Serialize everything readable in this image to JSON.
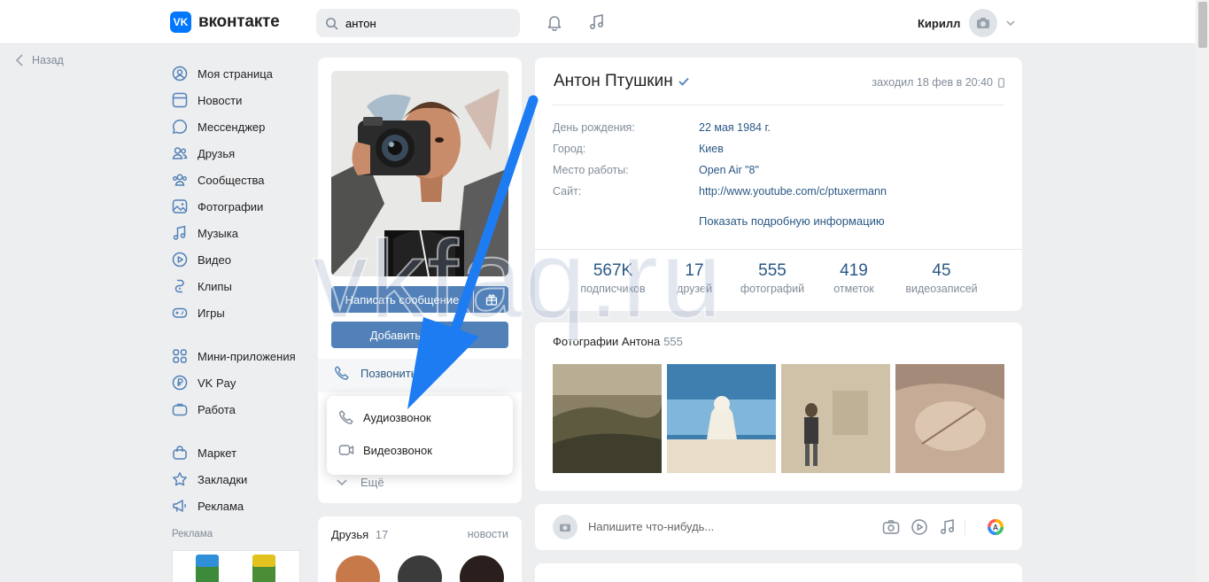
{
  "header": {
    "logo_text": "вконтакте",
    "search_value": "антон",
    "user_name": "Кирилл"
  },
  "back_label": "Назад",
  "nav": {
    "group1": [
      "Моя страница",
      "Новости",
      "Мессенджер",
      "Друзья",
      "Сообщества",
      "Фотографии",
      "Музыка",
      "Видео",
      "Клипы",
      "Игры"
    ],
    "group2": [
      "Мини-приложения",
      "VK Pay",
      "Работа"
    ],
    "group3": [
      "Маркет",
      "Закладки",
      "Реклама"
    ],
    "ad_title": "Реклама"
  },
  "profile": {
    "write_message": "Написать сообщение",
    "add_friend": "Добавить в друзья",
    "call": "Позвонить",
    "more": "Ещё",
    "call_menu": {
      "audio": "Аудиозвонок",
      "video": "Видеозвонок"
    }
  },
  "friends": {
    "title": "Друзья",
    "count": "17",
    "news": "новости"
  },
  "info": {
    "name": "Антон Птушкин",
    "last_seen": "заходил 18 фев в 20:40",
    "rows": [
      {
        "label": "День рождения:",
        "value": "22 мая 1984 г."
      },
      {
        "label": "Город:",
        "value": "Киев"
      },
      {
        "label": "Место работы:",
        "value": "Open Air \"8\""
      },
      {
        "label": "Сайт:",
        "value": "http://www.youtube.com/c/ptuxermann"
      }
    ],
    "more_info": "Показать подробную информацию",
    "counters": [
      {
        "num": "567K",
        "label": "подписчиков"
      },
      {
        "num": "17",
        "label": "друзей"
      },
      {
        "num": "555",
        "label": "фотографий"
      },
      {
        "num": "419",
        "label": "отметок"
      },
      {
        "num": "45",
        "label": "видеозаписей"
      }
    ]
  },
  "photos": {
    "title": "Фотографии Антона",
    "count": "555"
  },
  "post": {
    "placeholder": "Напишите что-нибудь..."
  },
  "watermark": "vkfaq.ru",
  "colors": {
    "accent": "#5181b8",
    "link": "#2a5885",
    "arrow": "#1e7cf2",
    "background": "#edeef0"
  }
}
